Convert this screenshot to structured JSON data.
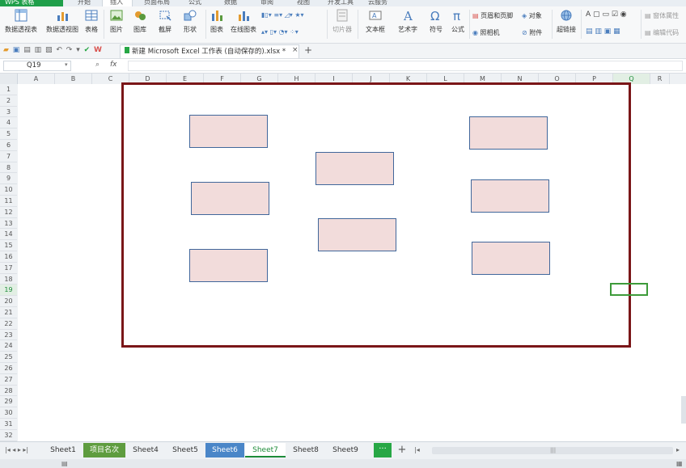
{
  "menu": {
    "app_name": "WPS 表格",
    "tabs": [
      "开始",
      "插入",
      "页面布局",
      "公式",
      "数据",
      "审阅",
      "视图",
      "开发工具",
      "云服务"
    ]
  },
  "ribbon": {
    "pivot_table": "数据透视表",
    "pivot_chart": "数据透视图",
    "table": "表格",
    "picture": "图片",
    "gallery": "图库",
    "screenshot": "截屏",
    "shapes": "形状",
    "chart": "图表",
    "online_chart": "在线图表",
    "slicer": "切片器",
    "textbox": "文本框",
    "wordart": "艺术字",
    "symbol": "符号",
    "formula": "公式",
    "header_footer": "页眉和页脚",
    "object": "对象",
    "camera": "照相机",
    "attachment": "附件",
    "hyperlink": "超链接",
    "form_props": "窗体属性",
    "edit_code": "编辑代码"
  },
  "doc_tab": {
    "title": "新建 Microsoft Excel 工作表 (自动保存的).xlsx *"
  },
  "formula_bar": {
    "name_box": "Q19",
    "fx": "fx"
  },
  "columns": [
    "A",
    "B",
    "C",
    "D",
    "E",
    "F",
    "G",
    "H",
    "I",
    "J",
    "K",
    "L",
    "M",
    "N",
    "O",
    "P",
    "Q",
    "R"
  ],
  "rows": [
    "1",
    "2",
    "3",
    "4",
    "5",
    "6",
    "7",
    "8",
    "9",
    "10",
    "11",
    "12",
    "13",
    "14",
    "15",
    "16",
    "17",
    "18",
    "19",
    "20",
    "21",
    "22",
    "23",
    "24",
    "25",
    "26",
    "27",
    "28",
    "29",
    "30",
    "31",
    "32"
  ],
  "selected_cell": {
    "column": "Q",
    "row": "19"
  },
  "sheets": [
    {
      "name": "Sheet1",
      "style": "plain"
    },
    {
      "name": "项目名次",
      "style": "green"
    },
    {
      "name": "Sheet4",
      "style": "plain"
    },
    {
      "name": "Sheet5",
      "style": "plain"
    },
    {
      "name": "Sheet6",
      "style": "blue"
    },
    {
      "name": "Sheet7",
      "style": "active"
    },
    {
      "name": "Sheet8",
      "style": "plain"
    },
    {
      "name": "Sheet9",
      "style": "plain"
    }
  ],
  "colors": {
    "frame": "#7a1618",
    "box_fill": "#f2dcdb",
    "box_border": "#41679b",
    "accent": "#1f9f4a"
  }
}
